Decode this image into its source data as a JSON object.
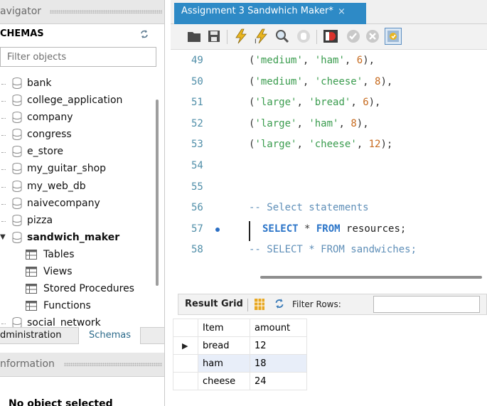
{
  "navigator": {
    "header_title": "avigator",
    "schemas_label": "CHEMAS",
    "filter_placeholder": "Filter objects",
    "schemas": [
      {
        "name": "bank"
      },
      {
        "name": "college_application"
      },
      {
        "name": "company"
      },
      {
        "name": "congress"
      },
      {
        "name": "e_store"
      },
      {
        "name": "my_guitar_shop"
      },
      {
        "name": "my_web_db"
      },
      {
        "name": "naivecompany"
      },
      {
        "name": "pizza"
      },
      {
        "name": "sandwich_maker",
        "expanded": true
      },
      {
        "name": "social_network"
      }
    ],
    "sandwich_children": [
      "Tables",
      "Views",
      "Stored Procedures",
      "Functions"
    ],
    "tabs": {
      "administration": "dministration",
      "schemas": "Schemas"
    },
    "information_title": "nformation",
    "no_object": "No object selected"
  },
  "editor": {
    "tab_title": "Assignment 3 Sandwhich Maker*",
    "tab_close": "×",
    "lines": [
      {
        "num": "49",
        "text": "('medium', 'ham', 6),"
      },
      {
        "num": "50",
        "text": "('medium', 'cheese', 8),"
      },
      {
        "num": "51",
        "text": "('large', 'bread', 6),"
      },
      {
        "num": "52",
        "text": "('large', 'ham', 8),"
      },
      {
        "num": "53",
        "text": "('large', 'cheese', 12);"
      },
      {
        "num": "54",
        "text": ""
      },
      {
        "num": "55",
        "text": ""
      },
      {
        "num": "56",
        "text": "-- Select statements"
      },
      {
        "num": "57",
        "text": "SELECT * FROM resources;"
      },
      {
        "num": "58",
        "text": "-- SELECT * FROM sandwiches;"
      }
    ],
    "current_line": "57"
  },
  "toolbar": {
    "icons": [
      "open-file-icon",
      "save-icon",
      "execute-icon",
      "execute-current-icon",
      "explain-icon",
      "stop-icon",
      "toggle-error-icon",
      "commit-icon",
      "rollback-icon",
      "autocommit-icon"
    ]
  },
  "result": {
    "grid_label": "Result Grid",
    "filter_label": "Filter Rows:",
    "filter_value": "",
    "columns": [
      "Item",
      "amount"
    ],
    "rows": [
      [
        "bread",
        "12"
      ],
      [
        "ham",
        "18"
      ],
      [
        "cheese",
        "24"
      ]
    ]
  },
  "colors": {
    "accent_tab": "#2e8ac6",
    "keyword": "#2a74c8",
    "string": "#3a9c4e",
    "number": "#c76b1f",
    "comment": "#5f8fb8"
  }
}
